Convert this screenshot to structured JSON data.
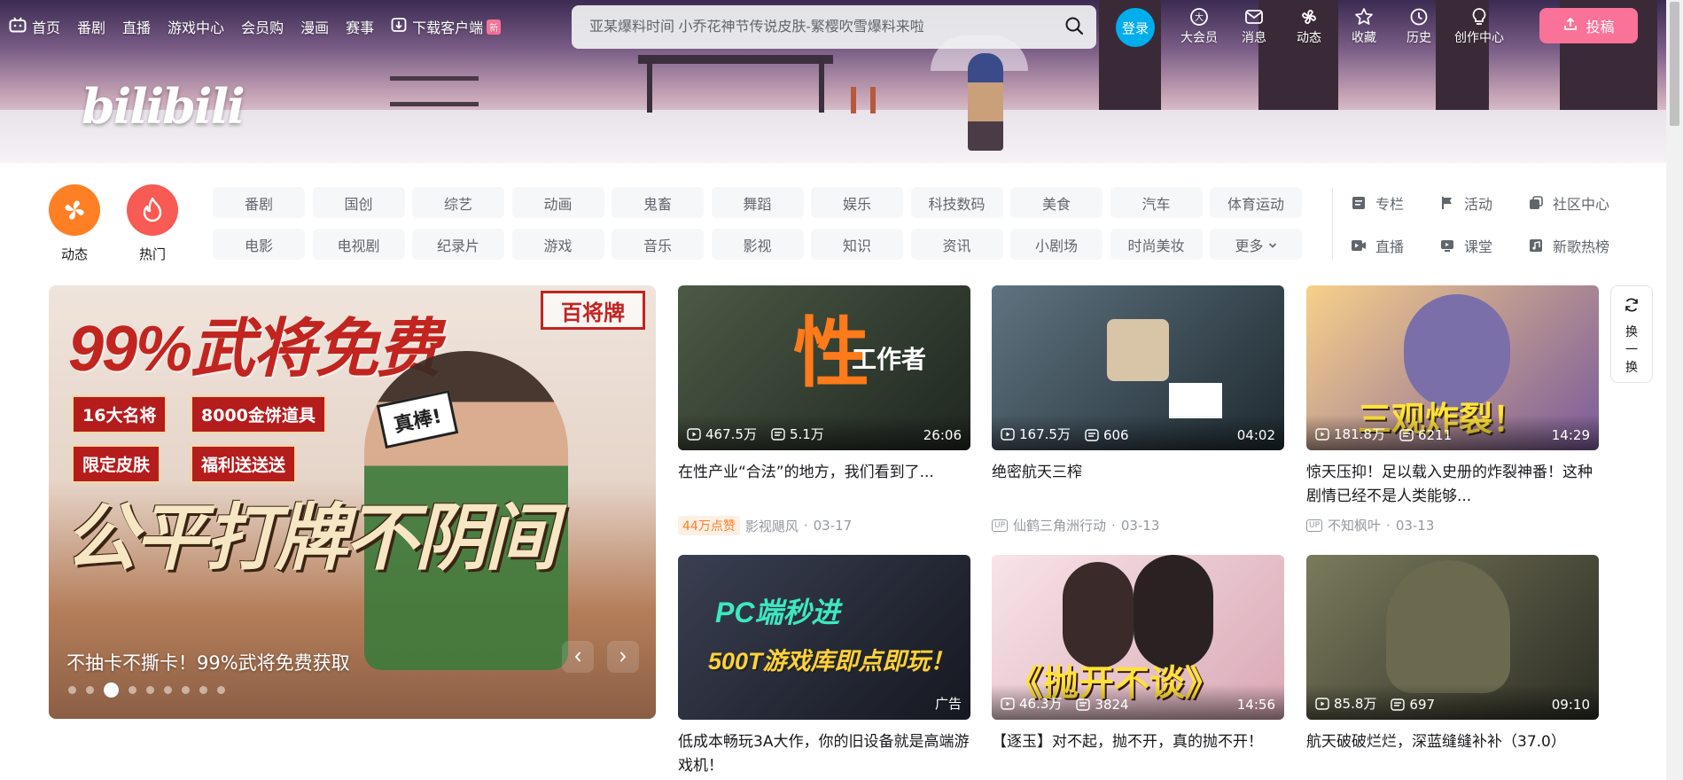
{
  "header": {
    "logo_text": "bilibili",
    "nav_left": [
      {
        "label": "首页",
        "icon": "tv-icon"
      },
      {
        "label": "番剧"
      },
      {
        "label": "直播"
      },
      {
        "label": "游戏中心"
      },
      {
        "label": "会员购"
      },
      {
        "label": "漫画"
      },
      {
        "label": "赛事"
      },
      {
        "label": "下载客户端",
        "icon": "download-icon",
        "badge": "新"
      }
    ],
    "search": {
      "placeholder": "亚某爆料时间 小乔花神节传说皮肤-繁樱吹雪爆料来啦",
      "icon": "search-icon"
    },
    "login_label": "登录",
    "nav_right": [
      {
        "label": "大会员",
        "icon": "vip-icon"
      },
      {
        "label": "消息",
        "icon": "mail-icon"
      },
      {
        "label": "动态",
        "icon": "dynamic-icon"
      },
      {
        "label": "收藏",
        "icon": "star-icon"
      },
      {
        "label": "历史",
        "icon": "clock-icon"
      },
      {
        "label": "创作中心",
        "icon": "bulb-icon"
      }
    ],
    "upload_label": "投稿"
  },
  "channels": {
    "big": [
      {
        "label": "动态",
        "color": "#ff7f24"
      },
      {
        "label": "热门",
        "color": "#f85a54"
      }
    ],
    "tags": [
      "番剧",
      "国创",
      "综艺",
      "动画",
      "鬼畜",
      "舞蹈",
      "娱乐",
      "科技数码",
      "美食",
      "汽车",
      "体育运动",
      "电影",
      "电视剧",
      "纪录片",
      "游戏",
      "音乐",
      "影视",
      "知识",
      "资讯",
      "小剧场",
      "时尚美妆",
      "更多"
    ],
    "side_links": [
      {
        "label": "专栏",
        "icon": "article-icon"
      },
      {
        "label": "活动",
        "icon": "flag-icon"
      },
      {
        "label": "社区中心",
        "icon": "community-icon"
      },
      {
        "label": "直播",
        "icon": "live-icon"
      },
      {
        "label": "课堂",
        "icon": "classroom-icon"
      },
      {
        "label": "新歌热榜",
        "icon": "music-icon"
      }
    ]
  },
  "carousel": {
    "headline": "99%武将免费",
    "stamp": "百将牌",
    "chips": [
      "16大名将",
      "8000金饼道具",
      "限定皮肤",
      "福利送送送"
    ],
    "badge": "真棒!",
    "slogan": "公平打牌不阴间",
    "caption": "不抽卡不撕卡！99%武将免费获取",
    "dot_count": 9,
    "active_dot": 3
  },
  "refresh": {
    "label": "换一换"
  },
  "videos": [
    {
      "views": "467.5万",
      "danmaku": "5.1万",
      "duration": "26:06",
      "title": "在性产业“合法”的地方，我们看到了...",
      "like_badge": "44万点赞",
      "author": "影视飓风",
      "date": "03-17",
      "overlay": "性",
      "overlay2": "工作者",
      "bg": "#3c4a3c"
    },
    {
      "views": "167.5万",
      "danmaku": "606",
      "duration": "04:02",
      "title": "绝密航天三榨",
      "author": "仙鹤三角洲行动",
      "date": "03-13",
      "bg": "#3e4d58"
    },
    {
      "views": "181.8万",
      "danmaku": "6211",
      "duration": "14:29",
      "title": "惊天压抑！足以载入史册的炸裂神番！这种剧情已经不是人类能够...",
      "author": "不知枫叶",
      "date": "03-13",
      "overlay": "三观炸裂！",
      "bg": "#e9b35e"
    },
    {
      "ad": "广告",
      "title": "低成本畅玩3A大作，你的旧设备就是高端游戏机！",
      "overlay": "PC端秒进",
      "overlay2": "500T游戏库即点即玩！",
      "bg": "#2a2f3a"
    },
    {
      "views": "46.3万",
      "danmaku": "3824",
      "duration": "14:56",
      "title": "【逐玉】对不起，抛不开，真的抛不开！",
      "overlay": "《抛开不谈》",
      "bg": "#f4d9de"
    },
    {
      "views": "85.8万",
      "danmaku": "697",
      "duration": "09:10",
      "title": "航天破破烂烂，深蓝缝缝补补（37.0）",
      "bg": "#5a5c4a"
    }
  ]
}
